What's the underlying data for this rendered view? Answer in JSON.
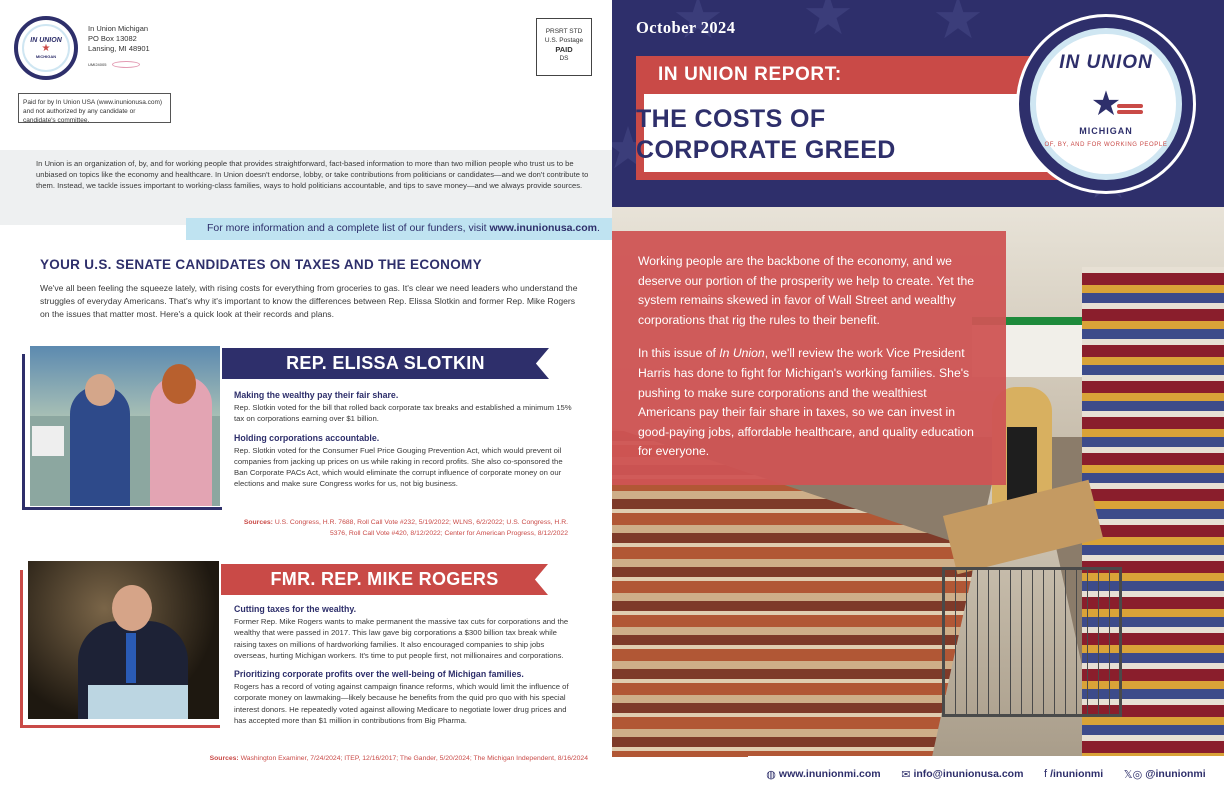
{
  "mailer": {
    "logo": {
      "line1": "IN UNION",
      "line2": "★",
      "line3": "MICHIGAN"
    },
    "return_address": [
      "In Union Michigan",
      "PO Box 13082",
      "Lansing, MI 48901"
    ],
    "code": "UMI24005",
    "postage": [
      "PRSRT STD",
      "U.S. Postage",
      "PAID",
      "DS"
    ],
    "paid_for": "Paid for by In Union USA (www.inunionusa.com) and not authorized by any candidate or candidate's committee."
  },
  "intro": {
    "text": "In Union is an organization of, by, and for working people that provides straightforward, fact-based information to more than two million people who trust us to be unbiased on topics like the economy and healthcare. In Union doesn't endorse, lobby, or take contributions from politicians or candidates—and we don't contribute to them. Instead, we tackle issues important to working-class families, ways to hold politicians accountable, and tips to save money—and we always provide sources.",
    "more_info_prefix": "For more information and a complete list of our funders, visit ",
    "more_info_link": "www.inunionusa.com",
    "more_info_suffix": "."
  },
  "senate": {
    "heading": "YOUR U.S. SENATE CANDIDATES ON TAXES AND THE ECONOMY",
    "intro": "We've all been feeling the squeeze lately, with rising costs for everything from groceries to gas. It's clear we need leaders who understand the struggles of everyday Americans. That's why it's important to know the differences between Rep. Elissa Slotkin and former Rep. Mike Rogers on the issues that matter most. Here's a quick look at their records and plans."
  },
  "slotkin": {
    "banner": "REP. ELISSA SLOTKIN",
    "h1": "Making the wealthy pay their fair share.",
    "p1": "Rep. Slotkin voted for the bill that rolled back corporate tax breaks and established a minimum 15% tax on corporations earning over $1 billion.",
    "h2": "Holding corporations accountable.",
    "p2": "Rep. Slotkin voted for the Consumer Fuel Price Gouging Prevention Act, which would prevent oil companies from jacking up prices on us while raking in record profits. She also co-sponsored the Ban Corporate PACs Act, which would eliminate the corrupt influence of corporate money on our elections and make sure Congress works for us, not big business.",
    "sources_label": "Sources:",
    "sources": "U.S. Congress, H.R. 7688, Roll Call Vote #232, 5/19/2022; WLNS, 6/2/2022; U.S. Congress, H.R. 5376, Roll Call Vote #420, 8/12/2022; Center for American Progress, 8/12/2022"
  },
  "rogers": {
    "banner": "FMR. REP. MIKE ROGERS",
    "h1": "Cutting taxes for the wealthy.",
    "p1": "Former Rep. Mike Rogers wants to make permanent the massive tax cuts for corporations and the wealthy that were passed in 2017. This law gave big corporations a $300 billion tax break while raising taxes on millions of hardworking families. It also encouraged companies to ship jobs overseas, hurting Michigan workers. It's time to put people first, not millionaires and corporations.",
    "h2": "Prioritizing corporate profits over the well-being of Michigan families.",
    "p2": "Rogers has a record of voting against campaign finance reforms, which would limit the influence of corporate money on lawmaking—likely because he benefits from the quid pro quo with his special interest donors. He repeatedly voted against allowing Medicare to negotiate lower drug prices and has accepted more than $1 million in contributions from Big Pharma.",
    "sources_label": "Sources:",
    "sources": "Washington Examiner, 7/24/2024; ITEP, 12/16/2017; The Gander, 5/20/2024; The Michigan Independent, 8/16/2024"
  },
  "cover": {
    "date": "October 2024",
    "report_label": "IN UNION REPORT:",
    "title_line1": "THE COSTS OF",
    "title_line2": "CORPORATE GREED",
    "badge": {
      "top": "IN UNION",
      "state": "MICHIGAN",
      "tagline": "OF, BY, AND FOR WORKING PEOPLE"
    },
    "p1": "Working people are the backbone of the economy, and we deserve our portion of the prosperity we help to create. Yet the system remains skewed in favor of Wall Street and wealthy corporations that rig the rules to their benefit.",
    "p2_prefix": "In this issue of ",
    "p2_em": "In Union",
    "p2_rest": ", we'll review the work Vice President Harris has done to fight for Michigan's working families. She's pushing to make sure corporations and the wealthiest Americans pay their fair share in taxes, so we can invest in good-paying jobs, affordable healthcare, and quality education for everyone."
  },
  "footer": {
    "web": "www.inunionmi.com",
    "email": "info@inunionusa.com",
    "facebook": "/inunionmi",
    "social": "@inunionmi",
    "web_icon": "globe-icon",
    "email_icon": "envelope-icon",
    "facebook_icon": "facebook-icon",
    "social_icon": "x-instagram-icon"
  },
  "colors": {
    "navy": "#2e2f6b",
    "red": "#c94a47",
    "light_blue": "#bfe3f1"
  }
}
